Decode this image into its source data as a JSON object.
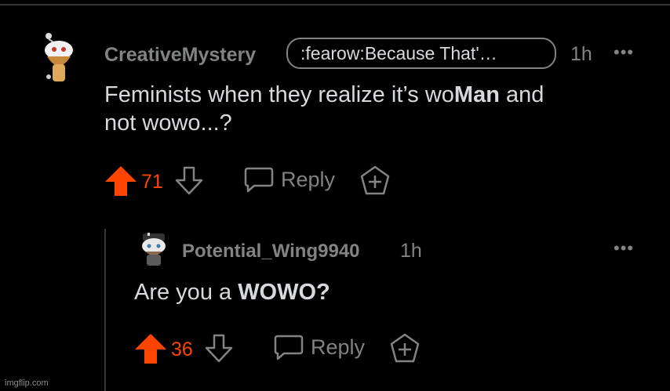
{
  "comment": {
    "username": "CreativeMystery",
    "flair": ":fearow:Because That'…",
    "time": "1h",
    "more_icon": "•••",
    "text_pre": "Feminists when they realize it’s wo",
    "text_bold": "Man",
    "text_mid": " and",
    "text_line2": "not wowo...?",
    "votes": "71",
    "reply_label": "Reply"
  },
  "reply_comment": {
    "username": "Potential_Wing9940",
    "time": "1h",
    "more_icon": "•••",
    "text_pre": "Are you a ",
    "text_bold": "WOWO?",
    "votes": "36",
    "reply_label": "Reply"
  },
  "watermark": "imgflip.com",
  "colors": {
    "background": "#000000",
    "upvote": "#ff4500",
    "muted": "#818384",
    "text": "#d7dadc"
  },
  "icons": [
    "snoo-avatar-icon",
    "upvote-arrow-icon",
    "downvote-arrow-icon",
    "comment-bubble-icon",
    "award-plus-icon",
    "more-dots-icon"
  ]
}
